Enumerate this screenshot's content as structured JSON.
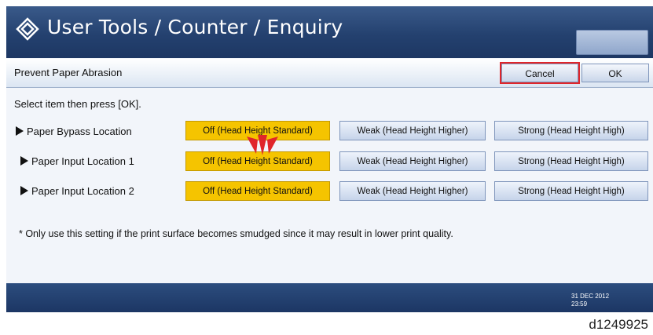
{
  "header": {
    "title": "User Tools / Counter / Enquiry"
  },
  "subheader": {
    "title": "Prevent Paper Abrasion",
    "cancel_label": "Cancel",
    "ok_label": "OK"
  },
  "instruction": "Select item then press [OK].",
  "rows": [
    {
      "label": "Paper Bypass Location",
      "options": [
        "Off (Head Height Standard)",
        "Weak (Head Height Higher)",
        "Strong (Head Height High)"
      ],
      "selected_index": 0
    },
    {
      "label": "Paper Input Location 1",
      "options": [
        "Off (Head Height Standard)",
        "Weak (Head Height Higher)",
        "Strong (Head Height High)"
      ],
      "selected_index": 0
    },
    {
      "label": "Paper Input Location 2",
      "options": [
        "Off (Head Height Standard)",
        "Weak (Head Height Higher)",
        "Strong (Head Height High)"
      ],
      "selected_index": 0
    }
  ],
  "note": "* Only use this setting if the print surface becomes smudged since it may result in lower print quality.",
  "footer": {
    "date": "31 DEC 2012",
    "time": "23:59"
  },
  "caption": "d1249925",
  "colors": {
    "selected": "#f5c400",
    "titlebar": "#24416f",
    "cancel_highlight": "#e0262b",
    "callout_arrows": "#e0262b"
  },
  "icons": {
    "title": "diamond-logo-icon",
    "row_marker": "triangle-right-icon",
    "callout": "red-arrows-icon"
  }
}
